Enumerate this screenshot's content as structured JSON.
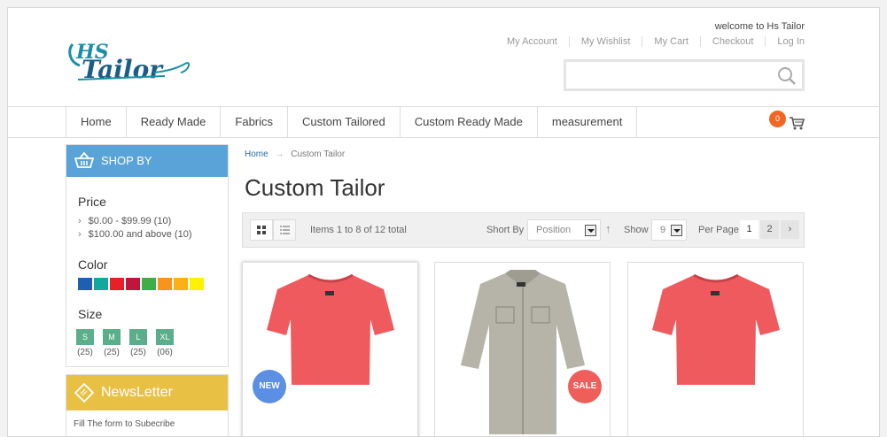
{
  "brand": {
    "logo_text": "HS Tailor"
  },
  "header": {
    "welcome": "welcome to Hs Tailor",
    "links": [
      "My Account",
      "My Wishlist",
      "My Cart",
      "Checkout",
      "Log In"
    ],
    "search_placeholder": ""
  },
  "nav": {
    "items": [
      "Home",
      "Ready Made",
      "Fabrics",
      "Custom Tailored",
      "Custom Ready Made",
      "measurement"
    ],
    "cart_count": "0"
  },
  "sidebar": {
    "shopby_title": "SHOP BY",
    "price_title": "Price",
    "price_options": [
      "$0.00 - $99.99 (10)",
      "$100.00 and above (10)"
    ],
    "color_title": "Color",
    "colors": [
      "#1f5fb0",
      "#13a89e",
      "#e81f27",
      "#c0153d",
      "#3fae49",
      "#f7941d",
      "#fbb016",
      "#fff200"
    ],
    "size_title": "Size",
    "sizes": [
      {
        "label": "S",
        "count": "(25)"
      },
      {
        "label": "M",
        "count": "(25)"
      },
      {
        "label": "L",
        "count": "(25)"
      },
      {
        "label": "XL",
        "count": "(06)"
      }
    ],
    "newsletter_title": "NewsLetter",
    "newsletter_text": "Fill The form to Subecribe"
  },
  "main": {
    "breadcrumb": {
      "home": "Home",
      "current": "Custom Tailor"
    },
    "title": "Custom Tailor",
    "toolbar": {
      "items_count": "Items 1 to 8 of 12 total",
      "sort_label": "Short By",
      "sort_value": "Position",
      "show_label": "Show",
      "show_value": "9",
      "perpage_label": "Per Page",
      "pages": [
        "1",
        "2"
      ],
      "current_page": "1"
    },
    "products": [
      {
        "ribbon": "NEW",
        "shirt_color": "#ef5a5e"
      },
      {
        "ribbon": "SALE",
        "shirt_color": "#b6b4a8"
      },
      {
        "ribbon": "",
        "shirt_color": "#ef5a5e"
      }
    ]
  },
  "colors": {
    "accent_blue": "#5aa3d8",
    "newsletter_yellow": "#e8c144",
    "badge_orange": "#f26522",
    "size_green": "#5bae8b"
  }
}
